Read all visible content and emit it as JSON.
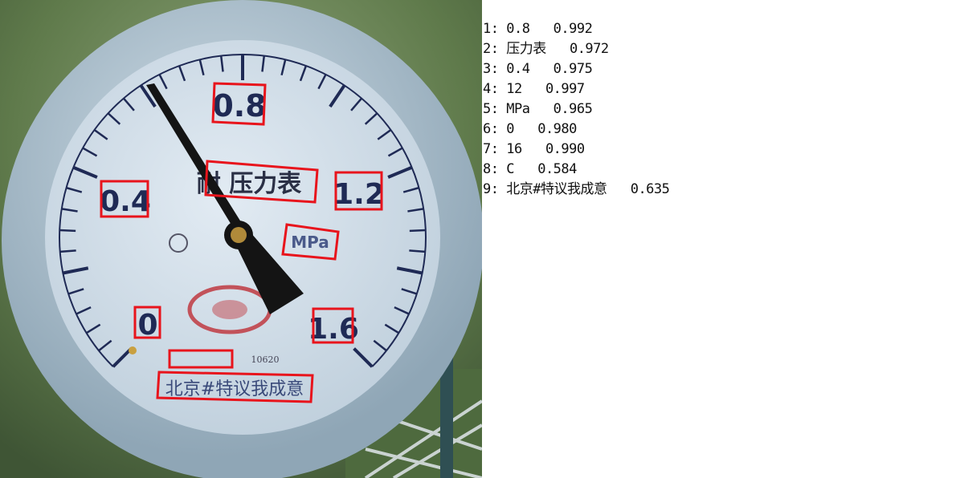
{
  "photo": {
    "sky_color": "#6e8a58",
    "bezel_color": "#b7cad6",
    "face_color": "#d6e0ea",
    "ink_color": "#1f2a55",
    "box_color": "#e8141c",
    "needle_color": "#141414",
    "seal_color": "#c2525a"
  },
  "dial": {
    "numbers": [
      "0",
      "0.4",
      "0.8",
      "1.2",
      "1.6"
    ],
    "unit": "MPa",
    "title": "耐 压力表",
    "maker": "北京#特议我成意",
    "serial": "10620"
  },
  "results": [
    {
      "index": "1",
      "text": "0.8",
      "score": "0.992"
    },
    {
      "index": "2",
      "text": "压力表",
      "score": "0.972"
    },
    {
      "index": "3",
      "text": "0.4",
      "score": "0.975"
    },
    {
      "index": "4",
      "text": "12",
      "score": "0.997"
    },
    {
      "index": "5",
      "text": "MPa",
      "score": "0.965"
    },
    {
      "index": "6",
      "text": "0",
      "score": "0.980"
    },
    {
      "index": "7",
      "text": "16",
      "score": "0.990"
    },
    {
      "index": "8",
      "text": "C",
      "score": "0.584"
    },
    {
      "index": "9",
      "text": "北京#特议我成意",
      "score": "0.635"
    }
  ]
}
